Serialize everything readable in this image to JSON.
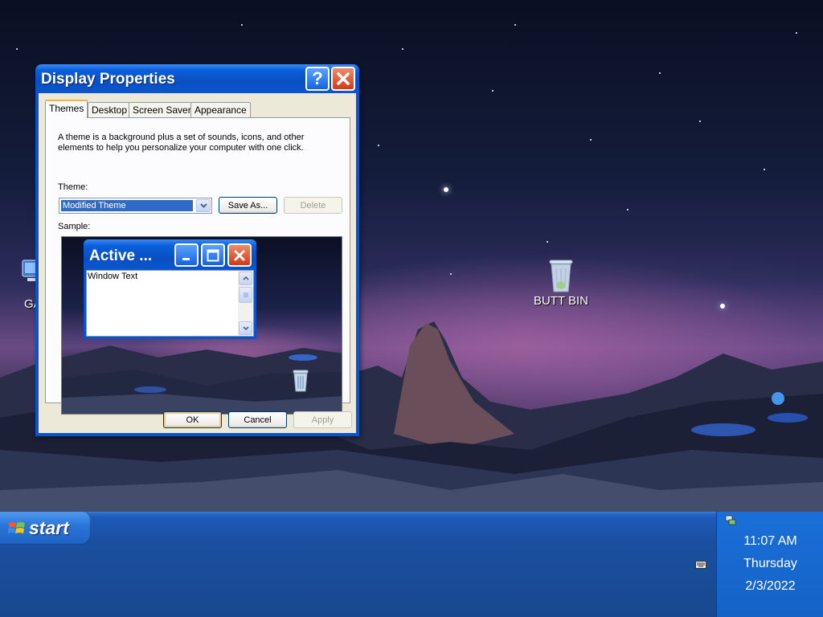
{
  "desktop": {
    "icons": [
      {
        "label": "BUTT BIN",
        "icon": "recycle-bin-icon"
      },
      {
        "label": "GA",
        "icon": "computer-icon"
      }
    ]
  },
  "window": {
    "title": "Display Properties",
    "help_glyph": "?",
    "tabs": [
      {
        "label": "Themes",
        "active": true
      },
      {
        "label": "Desktop",
        "active": false
      },
      {
        "label": "Screen Saver",
        "active": false
      },
      {
        "label": "Appearance",
        "active": false
      }
    ],
    "description": "A theme is a background plus a set of sounds, icons, and other elements to help you personalize your computer with one click.",
    "theme_label": "Theme:",
    "theme_value": "Modified Theme",
    "save_as_label": "Save As...",
    "delete_label": "Delete",
    "sample_label": "Sample:",
    "sample": {
      "window_title": "Active ...",
      "window_text": "Window Text"
    },
    "ok_label": "OK",
    "cancel_label": "Cancel",
    "apply_label": "Apply"
  },
  "taskbar": {
    "start_label": "start",
    "clock": {
      "time": "11:07 AM",
      "day": "Thursday",
      "date": "2/3/2022"
    }
  },
  "colors": {
    "title_blue": "#0a53c8",
    "taskbar_blue": "#1d5ab8",
    "start_green": "#2b76d9",
    "close_red": "#d33a14"
  }
}
